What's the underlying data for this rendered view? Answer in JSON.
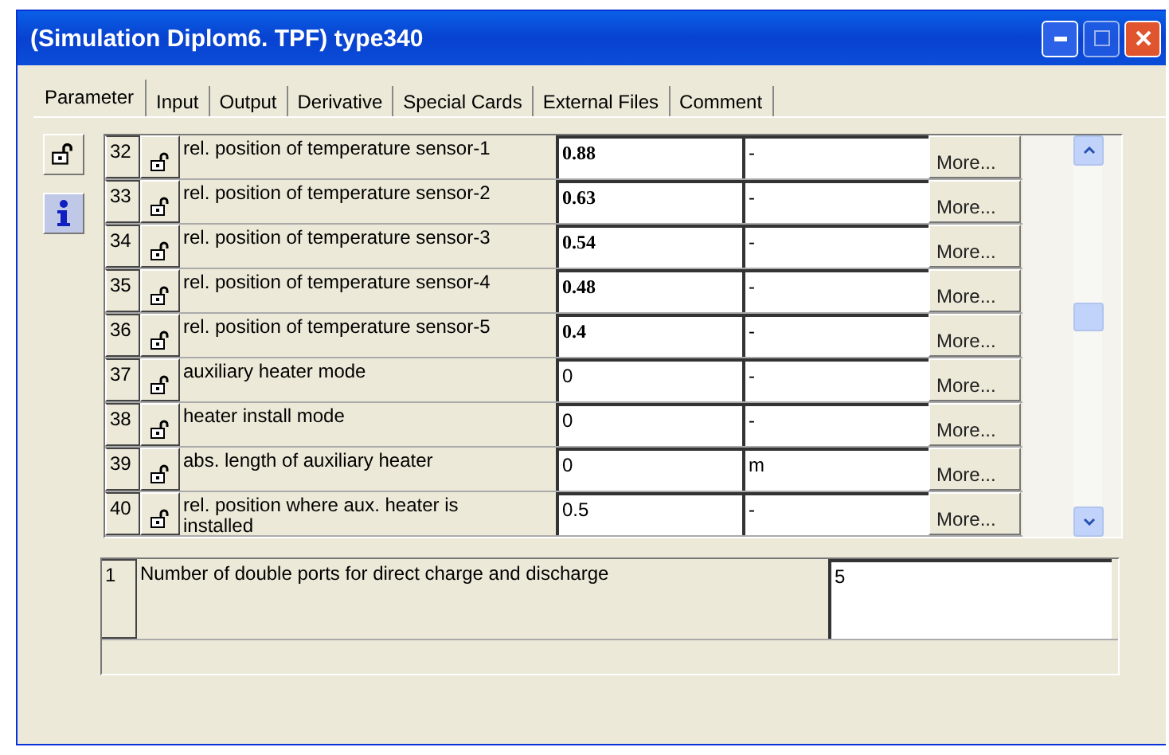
{
  "window": {
    "title": "(Simulation Diplom6. TPF) type340"
  },
  "tabs": [
    {
      "label": "Parameter",
      "selected": true
    },
    {
      "label": "Input",
      "selected": false
    },
    {
      "label": "Output",
      "selected": false
    },
    {
      "label": "Derivative",
      "selected": false
    },
    {
      "label": "Special Cards",
      "selected": false
    },
    {
      "label": "External Files",
      "selected": false
    },
    {
      "label": "Comment",
      "selected": false
    }
  ],
  "parameters": [
    {
      "number": "32",
      "name": "rel. position of temperature sensor-1",
      "value": "0.88",
      "bold": true,
      "unit": "-",
      "button": "More..."
    },
    {
      "number": "33",
      "name": "rel. position of temperature sensor-2",
      "value": "0.63",
      "bold": true,
      "unit": "-",
      "button": "More..."
    },
    {
      "number": "34",
      "name": "rel. position of temperature sensor-3",
      "value": "0.54",
      "bold": true,
      "unit": "-",
      "button": "More..."
    },
    {
      "number": "35",
      "name": "rel. position of temperature sensor-4",
      "value": "0.48",
      "bold": true,
      "unit": "-",
      "button": "More..."
    },
    {
      "number": "36",
      "name": "rel. position of temperature sensor-5",
      "value": "0.4",
      "bold": true,
      "unit": "-",
      "button": "More..."
    },
    {
      "number": "37",
      "name": "auxiliary heater mode",
      "value": "0",
      "bold": false,
      "unit": "-",
      "button": "More..."
    },
    {
      "number": "38",
      "name": "heater install mode",
      "value": "0",
      "bold": false,
      "unit": "-",
      "button": "More..."
    },
    {
      "number": "39",
      "name": "abs. length of auxiliary heater",
      "value": "0",
      "bold": false,
      "unit": "m",
      "button": "More..."
    },
    {
      "number": "40",
      "name": "rel. position where aux. heater is installed",
      "value": "0.5",
      "bold": false,
      "unit": "-",
      "button": "More..."
    }
  ],
  "detail": {
    "number": "1",
    "name": "Number of double ports for direct charge and discharge",
    "value": "5"
  }
}
